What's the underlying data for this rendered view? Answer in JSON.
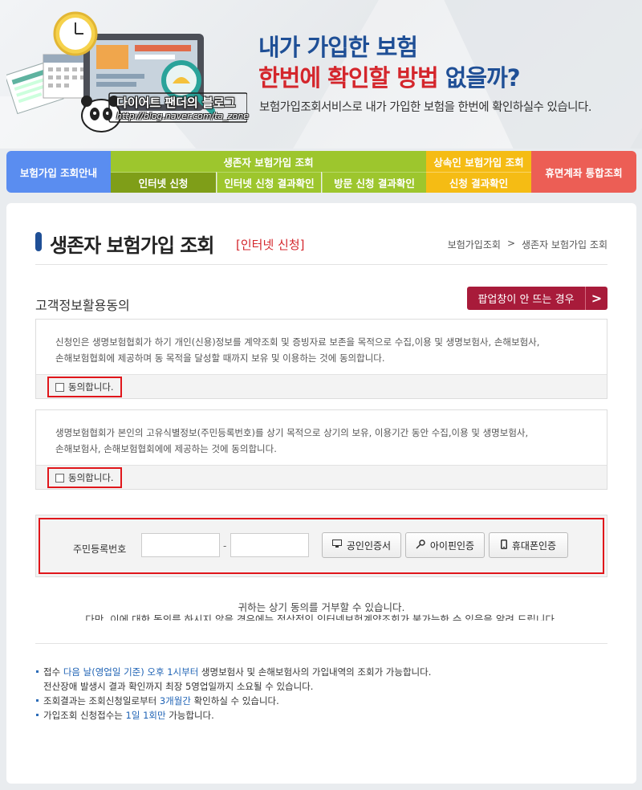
{
  "banner": {
    "headline_line1": "내가 가입한 보험",
    "headline_line2_red": "한번에 확인할 방법",
    "headline_line2_dark": " 없을까?",
    "subtitle": "보험가입조회서비스로 내가 가입한 보험을 한번에 확인하실수 있습니다.",
    "blog_title": "다이어트 팬더의 블로그",
    "blog_url": "http://blog.naver.com/ta_zone"
  },
  "nav": {
    "guide": "보험가입 조회안내",
    "survivor": "생존자 보험가입 조회",
    "survivor_sub": [
      "인터넷 신청",
      "인터넷 신청 결과확인",
      "방문 신청 결과확인"
    ],
    "heir": "상속인 보험가입 조회",
    "heir_sub": "신청 결과확인",
    "dormant": "휴면계좌 통합조회"
  },
  "page": {
    "title": "생존자 보험가입 조회",
    "subtitle": "[인터넷 신청]",
    "breadcrumb": [
      "보험가입조회",
      ">",
      "생존자 보험가입 조회"
    ]
  },
  "consent": {
    "section_label": "고객정보활용동의",
    "popup_button": "팝업창이 안 뜨는 경우",
    "popup_arrow": ">",
    "box1_line1": "신청인은 생명보험협회가 하기 개인(신용)정보를 계약조회 및 증빙자료 보존을 목적으로 수집,이용 및 생명보험사, 손해보험사,",
    "box1_line2": "손해보험협회에 제공하며 동 목적을 달성할 때까지 보유 및 이용하는 것에 동의합니다.",
    "box2_line1": "생명보험협회가 본인의 고유식별정보(주민등록번호)를 상기 목적으로 상기의 보유, 이용기간 동안 수집,이용 및 생명보험사,",
    "box2_line2": "손해보험사, 손해보험협회에에 제공하는 것에 동의합니다.",
    "agree_label": "동의합니다."
  },
  "identity": {
    "label": "주민등록번호",
    "dash": "-",
    "cert_button": "공인인증서",
    "ipin_button": "아이핀인증",
    "phone_button": "휴대폰인증"
  },
  "notice": {
    "line1": "귀하는 상기 동의를 거부할 수 있습니다.",
    "line2": "다만, 이에 대한 동의를 하시지 않을 경우에는 정상적인 인터넷보험계약조회가 불가능한 수 있음을 알려 드립니다."
  },
  "info": {
    "b1_pre": "접수 ",
    "b1_hl": "다음 날(영업일 기준) 오후 1시부터",
    "b1_post": " 생명보험사 및 손해보험사의 가입내역의 조회가 가능합니다.",
    "b1_cont": "전산장애 발생시 결과 확인까지 최장 5영업일까지 소요될 수 있습니다.",
    "b2_pre": "조회결과는 조회신청일로부터 ",
    "b2_hl": "3개월간",
    "b2_post": " 확인하실 수 있습니다.",
    "b3_pre": "가입조회 신청접수는 ",
    "b3_hl": "1일 1회만",
    "b3_post": " 가능합니다."
  },
  "colors": {
    "brand_blue": "#1f4f96",
    "accent_red": "#d4262c",
    "nav_blue": "#5a8df0",
    "nav_green": "#9dc62d",
    "nav_green_active": "#7f9e18",
    "nav_yellow": "#f5bc14",
    "nav_red": "#ec5e55",
    "popup_button": "#a81b3a",
    "highlight_frame": "#e0161b"
  }
}
